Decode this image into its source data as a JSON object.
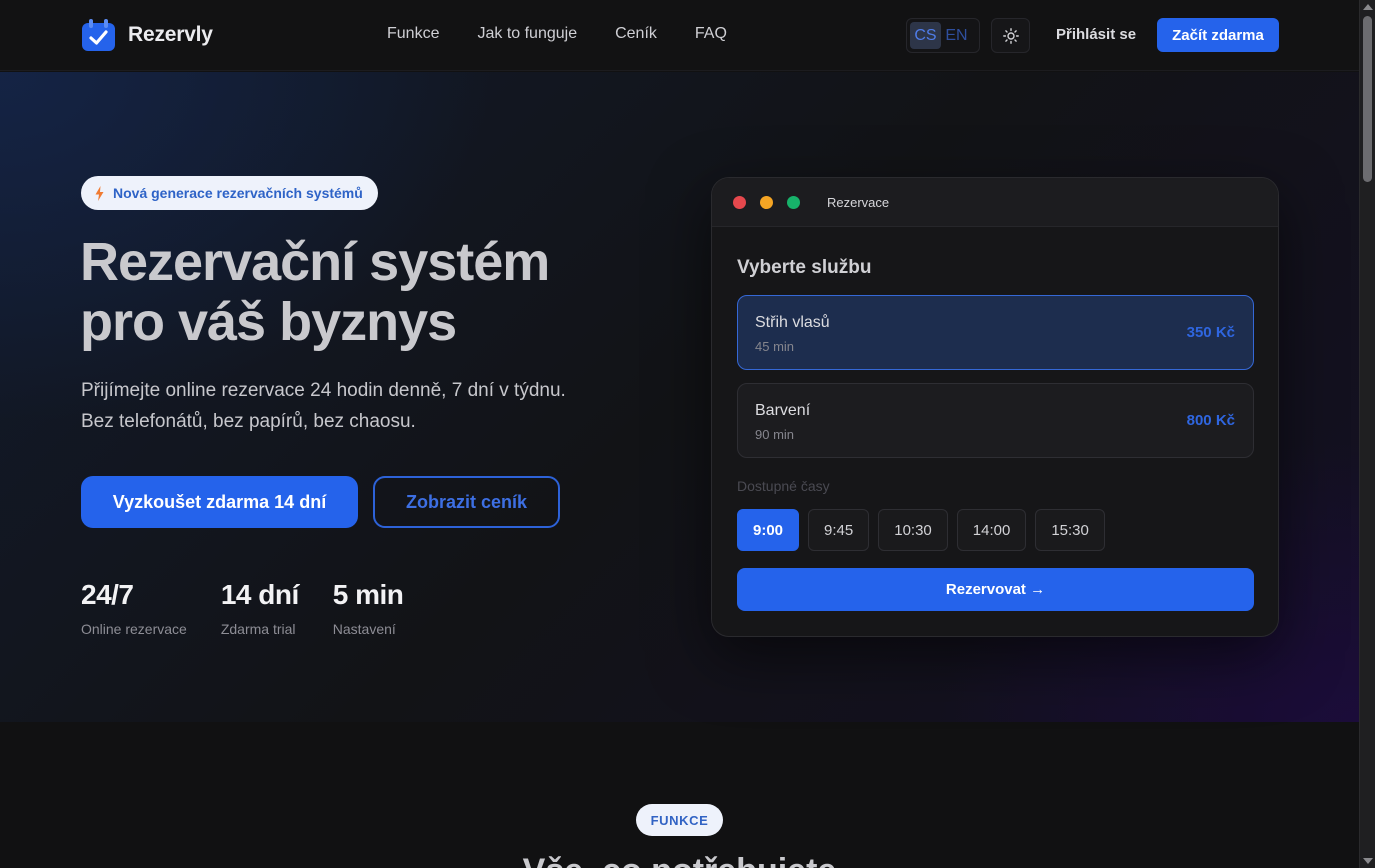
{
  "brand": {
    "name": "Rezervly",
    "logo_icon": "calendar-check-icon"
  },
  "nav": {
    "links": [
      "Funkce",
      "Jak to funguje",
      "Ceník",
      "FAQ"
    ],
    "lang": {
      "active": "CS",
      "other": "EN"
    },
    "theme_icon": "sun-icon",
    "login": "Přihlásit se",
    "cta": "Začít zdarma"
  },
  "hero": {
    "badge": {
      "icon": "lightning-icon",
      "text": "Nová generace rezervačních systémů"
    },
    "title_line1": "Rezervační systém",
    "title_line2": "pro váš byznys",
    "subtitle_line1": "Přijímejte online rezervace 24 hodin denně, 7 dní v týdnu.",
    "subtitle_line2": "Bez telefonátů, bez papírů, bez chaosu.",
    "primary_button": "Vyzkoušet zdarma 14 dní",
    "secondary_button": "Zobrazit ceník",
    "stats": [
      {
        "value": "24/7",
        "label": "Online rezervace"
      },
      {
        "value": "14 dní",
        "label": "Zdarma trial"
      },
      {
        "value": "5 min",
        "label": "Nastavení"
      }
    ]
  },
  "booking": {
    "window_title": "Rezervace",
    "window_dots": [
      "#e5484d",
      "#f5a524",
      "#17b26a"
    ],
    "heading": "Vyberte službu",
    "services": [
      {
        "name": "Střih vlasů",
        "duration": "45 min",
        "price": "350 Kč",
        "selected": true
      },
      {
        "name": "Barvení",
        "duration": "90 min",
        "price": "800 Kč",
        "selected": false
      }
    ],
    "times_label": "Dostupné časy",
    "times": [
      "9:00",
      "9:45",
      "10:30",
      "14:00",
      "15:30"
    ],
    "selected_time": "9:00",
    "reserve_button": "Rezervovat →"
  },
  "features": {
    "pill": "FUNKCE",
    "title": "Vše, co potřebujete"
  },
  "colors": {
    "accent": "#2563eb",
    "background": "#111112"
  }
}
